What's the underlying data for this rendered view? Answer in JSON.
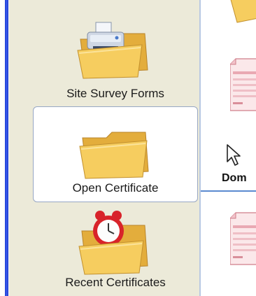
{
  "sidebar": {
    "items": [
      {
        "label": "Site Survey Forms",
        "icon": "printer-folder-icon"
      },
      {
        "label": "Open Certificate",
        "icon": "folder-icon",
        "selected": true
      },
      {
        "label": "Recent Certificates",
        "icon": "alarm-clock-folder-icon"
      }
    ]
  },
  "content": {
    "section_label": "Dom",
    "items": [
      {
        "icon": "folder-icon"
      },
      {
        "icon": "certificate-document-icon"
      },
      {
        "icon": "certificate-document-icon"
      }
    ]
  },
  "colors": {
    "sidebar_bg": "#ecead9",
    "frame_blue": "#2a47dc",
    "accent_line": "#5a8ad0",
    "folder_yellow": "#f3c757"
  }
}
